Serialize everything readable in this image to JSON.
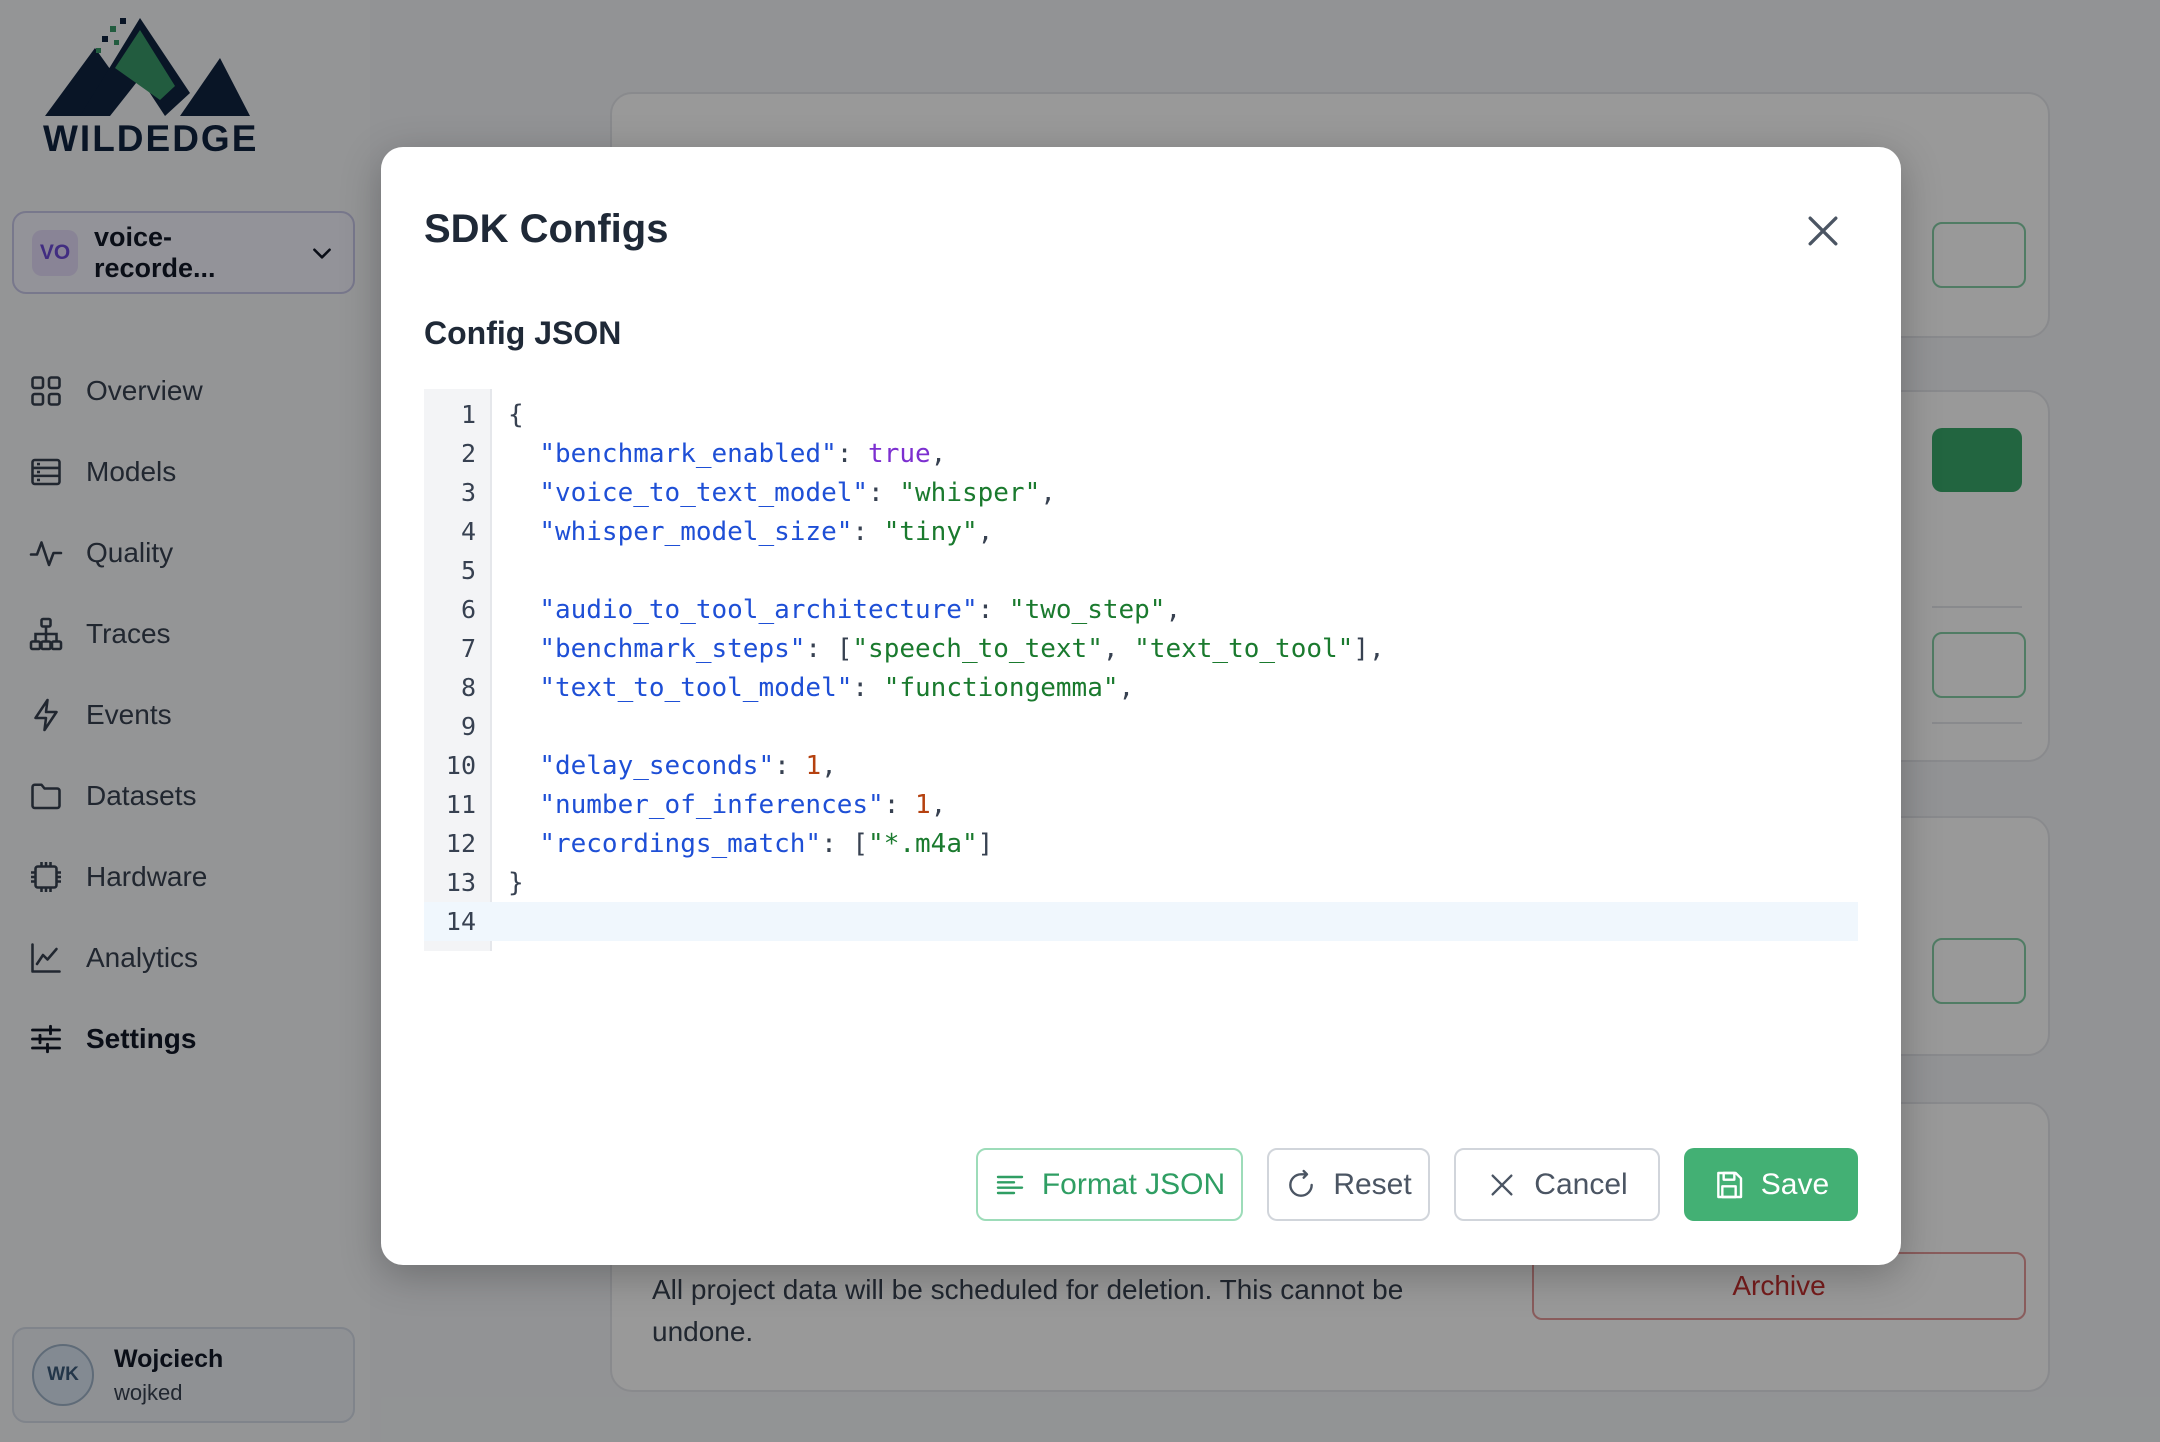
{
  "brand": {
    "name_part1": "WILD",
    "name_part2": "EDGE"
  },
  "project_switcher": {
    "badge": "VO",
    "name": "voice-recorde..."
  },
  "nav": {
    "items": [
      {
        "label": "Overview",
        "icon": "grid-icon"
      },
      {
        "label": "Models",
        "icon": "server-icon"
      },
      {
        "label": "Quality",
        "icon": "activity-icon"
      },
      {
        "label": "Traces",
        "icon": "hierarchy-icon"
      },
      {
        "label": "Events",
        "icon": "bolt-icon"
      },
      {
        "label": "Datasets",
        "icon": "folder-icon"
      },
      {
        "label": "Hardware",
        "icon": "chip-icon"
      },
      {
        "label": "Analytics",
        "icon": "line-chart-icon"
      },
      {
        "label": "Settings",
        "icon": "sliders-icon"
      }
    ],
    "active": "Settings"
  },
  "user": {
    "initials": "WK",
    "name": "Wojciech",
    "handle": "wojked"
  },
  "background_page": {
    "danger_text": "All project data will be scheduled for deletion. This cannot be undone.",
    "archive_label": "Archive"
  },
  "modal": {
    "title": "SDK Configs",
    "section_label": "Config JSON",
    "editor": {
      "line_numbers": [
        "1",
        "2",
        "3",
        "4",
        "5",
        "6",
        "7",
        "8",
        "9",
        "10",
        "11",
        "12",
        "13",
        "14"
      ],
      "active_line": 14,
      "json_text": "{\n  \"benchmark_enabled\": true,\n  \"voice_to_text_model\": \"whisper\",\n  \"whisper_model_size\": \"tiny\",\n\n  \"audio_to_tool_architecture\": \"two_step\",\n  \"benchmark_steps\": [\"speech_to_text\", \"text_to_tool\"],\n  \"text_to_tool_model\": \"functiongemma\",\n\n  \"delay_seconds\": 1,\n  \"number_of_inferences\": 1,\n  \"recordings_match\": [\"*.m4a\"]\n}\n"
    },
    "buttons": {
      "format": "Format JSON",
      "reset": "Reset",
      "cancel": "Cancel",
      "save": "Save"
    }
  },
  "colors": {
    "accent_green": "#43b074",
    "json_key": "#1e4fd6",
    "json_string": "#1a7a2e",
    "json_boolean": "#7c2fd0",
    "json_number": "#b5410f"
  }
}
